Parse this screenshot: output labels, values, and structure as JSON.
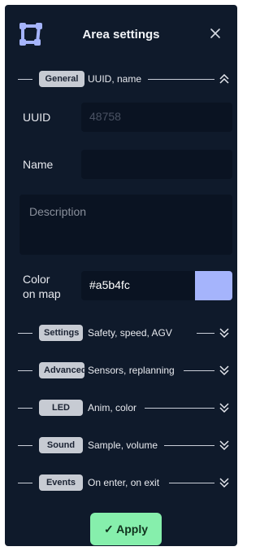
{
  "header": {
    "title": "Area settings",
    "logo_icon": "vector-square-icon",
    "close_icon": "close-icon"
  },
  "general": {
    "badge": "General",
    "summary": "UUID, name",
    "chevron": "chevron-up-double"
  },
  "fields": {
    "uuid_label": "UUID",
    "uuid_value": "48758",
    "name_label": "Name",
    "name_value": "",
    "description_placeholder": "Description",
    "color_label_line1": "Color",
    "color_label_line2": "on map",
    "color_value": "#a5b4fc"
  },
  "sections": [
    {
      "badge": "Settings",
      "summary": "Safety, speed, AGV",
      "chevron": "chevron-down-double"
    },
    {
      "badge": "Advanced",
      "summary": "Sensors, replanning",
      "chevron": "chevron-down-double"
    },
    {
      "badge": "LED",
      "summary": "Anim, color",
      "chevron": "chevron-down-double"
    },
    {
      "badge": "Sound",
      "summary": "Sample, volume",
      "chevron": "chevron-down-double"
    },
    {
      "badge": "Events",
      "summary": "On enter, on exit",
      "chevron": "chevron-down-double"
    }
  ],
  "apply": {
    "check": "✓",
    "label": "Apply"
  },
  "colors": {
    "panel": "#0f1a2b",
    "field": "#0a1322",
    "accent": "#a5b4fc",
    "apply": "#86efac"
  }
}
